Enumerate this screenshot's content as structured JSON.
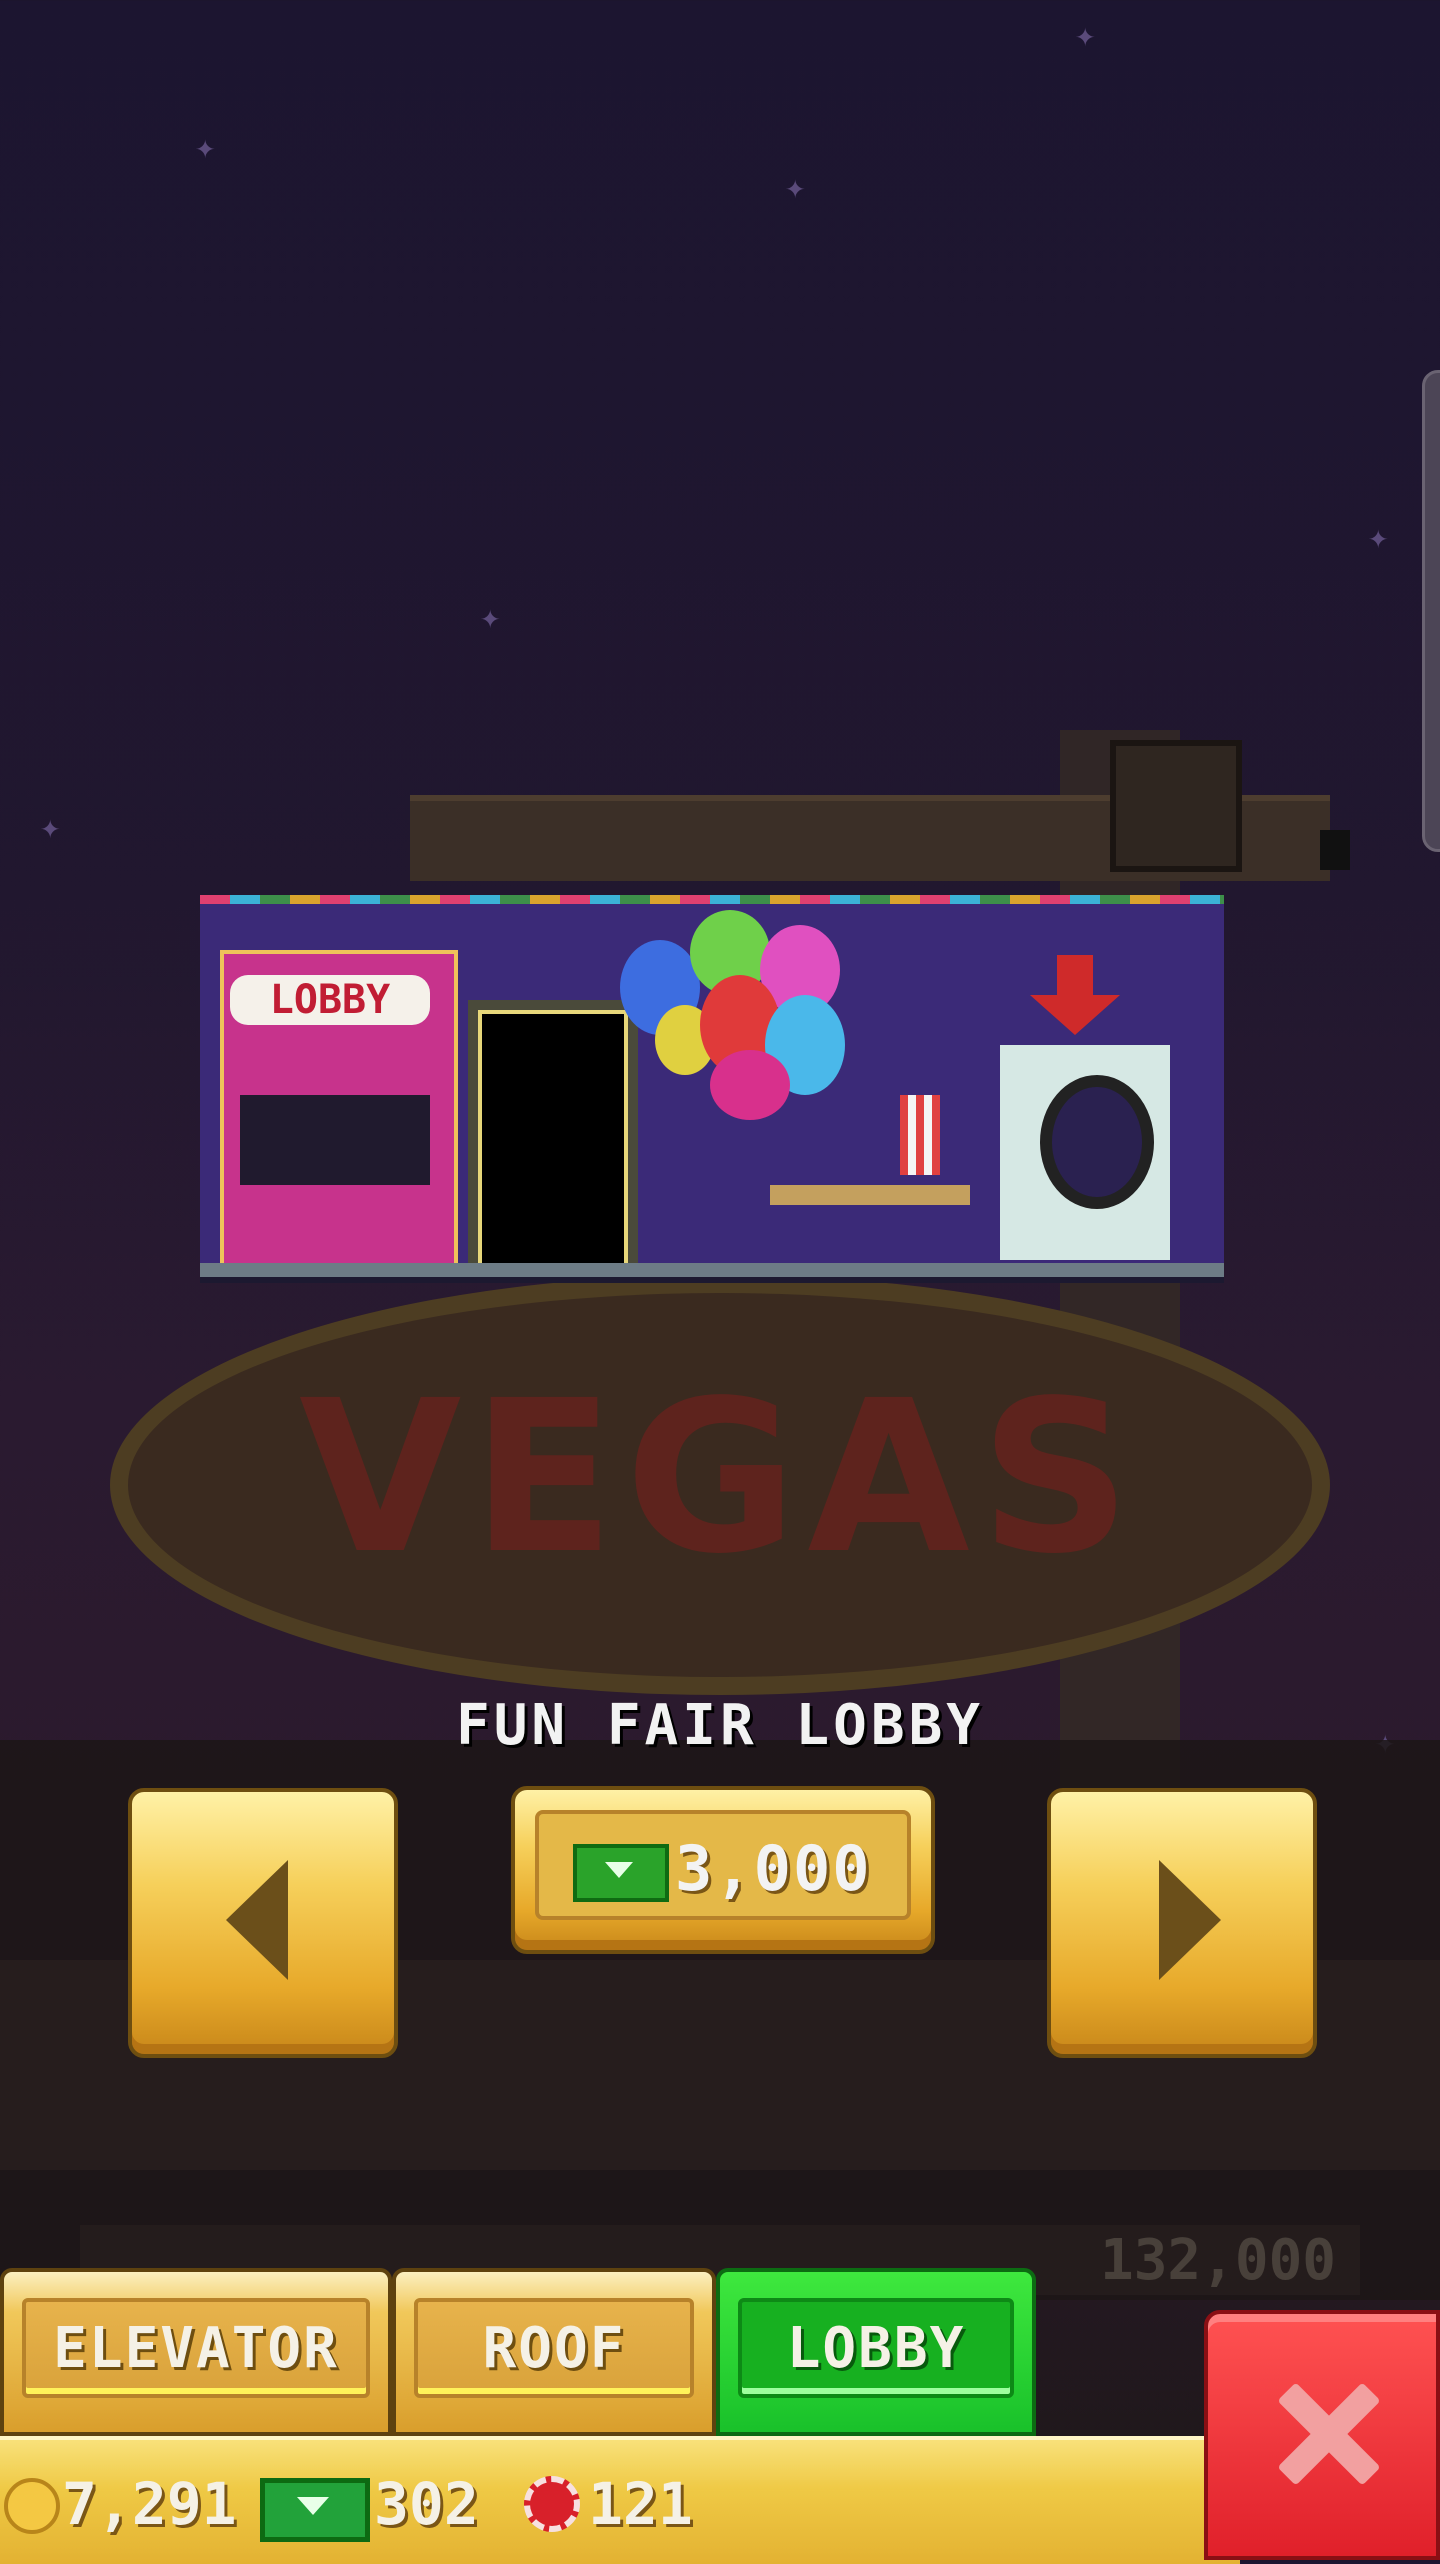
{
  "room": {
    "title": "FUN FAIR LOBBY",
    "preview_sign_text": "LOBBY",
    "background_sign_text": "VEGAS",
    "price": "3,000",
    "price_icon": "bux-icon"
  },
  "navigation": {
    "prev_icon": "arrow-left-icon",
    "next_icon": "arrow-right-icon"
  },
  "background_score": "132,000",
  "tabs": [
    {
      "label": "ELEVATOR",
      "selected": false
    },
    {
      "label": "ROOF",
      "selected": false
    },
    {
      "label": "LOBBY",
      "selected": true
    }
  ],
  "currency": {
    "coins": "7,291",
    "bux": "302",
    "chips": "121"
  },
  "colors": {
    "gold": "#f6d05b",
    "selected_tab": "#19c12a",
    "close": "#e0202a"
  }
}
